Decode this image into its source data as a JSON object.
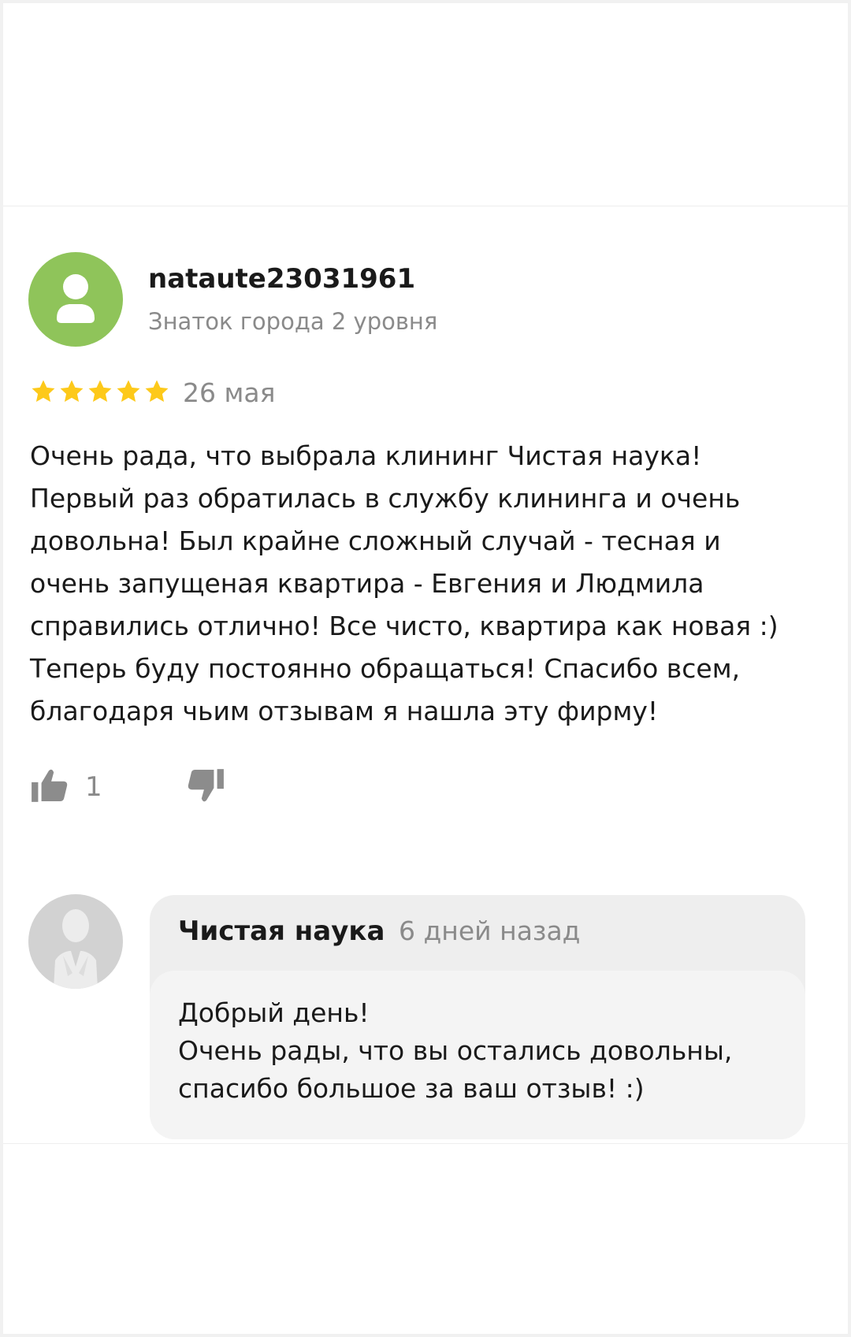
{
  "review": {
    "author_name": "nataute23031961",
    "author_level": "Знаток города 2 уровня",
    "rating": 5,
    "rating_max": 5,
    "date": "26 мая",
    "text": "Очень рада, что выбрала клининг Чистая наука!\nПервый раз обратилась в службу клининга и очень\nдовольна! Был крайне сложный случай - тесная и\nочень запущеная квартира - Евгения и Людмила\nсправились отлично! Все чисто, квартира как новая :)\nТеперь буду постоянно обращаться! Спасибо всем,\nблагодаря чьим отзывам я нашла эту фирму!",
    "likes": "1"
  },
  "reply": {
    "org_name": "Чистая наука",
    "date": "6 дней назад",
    "text": "Добрый день!\nОчень рады, что вы остались довольны,\nспасибо большое за ваш отзыв! :)"
  },
  "colors": {
    "avatar_bg": "#8fc45a",
    "star": "#fdc91a",
    "secondary_text": "#8a8a8a",
    "reply_bg": "#eeeeee",
    "reply_inner_bg": "#f4f4f4"
  },
  "icons": {
    "author_avatar": "user-silhouette-icon",
    "star": "star-icon",
    "like": "thumbs-up-icon",
    "dislike": "thumbs-down-icon",
    "org_avatar": "business-person-icon"
  }
}
